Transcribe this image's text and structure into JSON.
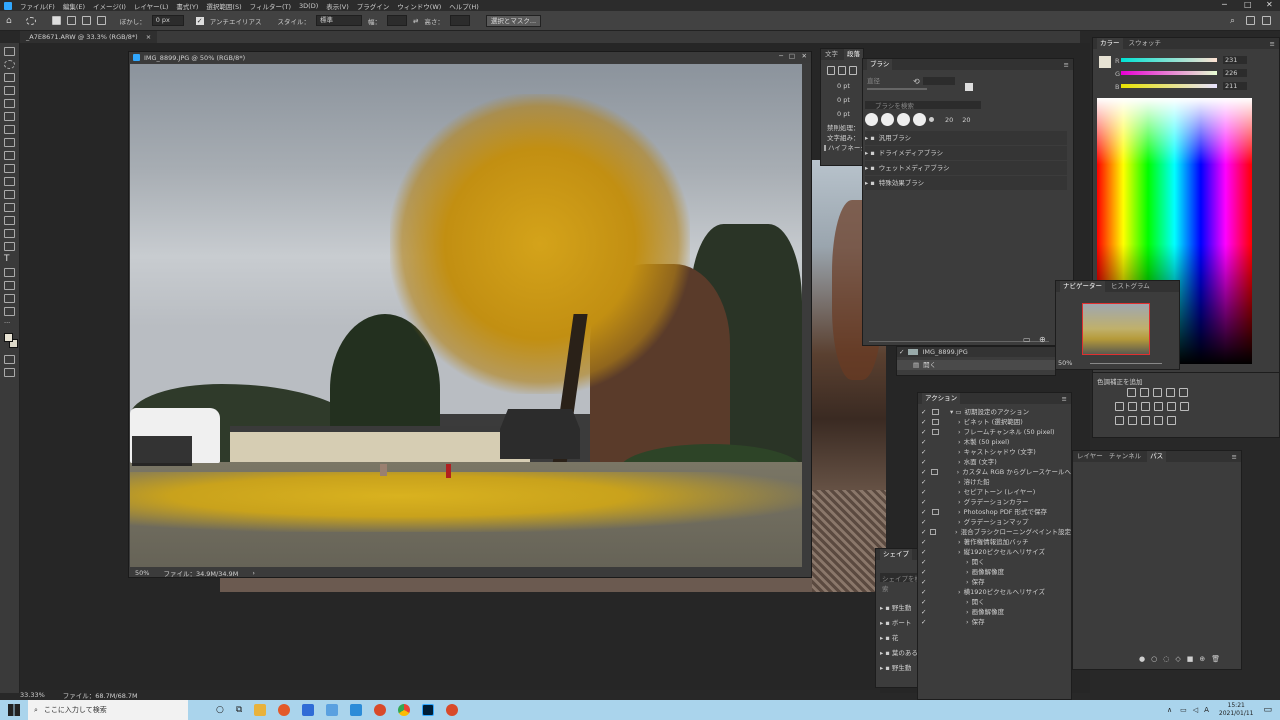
{
  "app": {
    "menus": [
      "ファイル(F)",
      "編集(E)",
      "イメージ(I)",
      "レイヤー(L)",
      "書式(Y)",
      "選択範囲(S)",
      "フィルター(T)",
      "3D(D)",
      "表示(V)",
      "プラグイン",
      "ウィンドウ(W)",
      "ヘルプ(H)"
    ]
  },
  "options": {
    "feather_label": "ぼかし：",
    "feather_value": "0 px",
    "antialias_label": "アンチエイリアス",
    "style_label": "スタイル：",
    "style_value": "標準",
    "width_label": "幅：",
    "height_label": "高さ：",
    "mask_button": "選択とマスク..."
  },
  "doctab": {
    "title": "_A7E8671.ARW @ 33.3% (RGB/8*)",
    "close": "×"
  },
  "document": {
    "title": "IMG_8899.JPG @ 50% (RGB/8*)",
    "zoom": "50%",
    "fileinfo": "ファイル：34.9M/34.9M"
  },
  "status": {
    "zoom": "33.33%",
    "fileinfo": "ファイル：68.7M/68.7M"
  },
  "charpanel": {
    "tabs": [
      "文字",
      "段落"
    ],
    "values": [
      "0 pt",
      "0 pt",
      "0 pt"
    ],
    "label1": "禁則処理：",
    "label2": "文字組み：",
    "hyphen": "ハイフネーシ"
  },
  "brushes": {
    "title": "ブラシ",
    "size_label": "直径",
    "search": "ブラシを検索",
    "sizes": [
      "20",
      "20"
    ],
    "groups": [
      "汎用ブラシ",
      "ドライメディアブラシ",
      "ウェットメディアブラシ",
      "特殊効果ブラシ"
    ]
  },
  "color": {
    "tabs": [
      "カラー",
      "スウォッチ"
    ],
    "r": "231",
    "g": "226",
    "b": "211",
    "labels": [
      "R",
      "G",
      "B"
    ]
  },
  "navigator": {
    "tabs": [
      "ナビゲーター",
      "ヒストグラム"
    ],
    "zoom": "50%"
  },
  "adjust": {
    "title": "色調補正を追加"
  },
  "layers": {
    "tabs": [
      "レイヤー",
      "チャンネル",
      "パス"
    ],
    "row1": "IMG_8899.JPG",
    "row2": "開く"
  },
  "actions": {
    "title": "アクション",
    "items": [
      "初期設定のアクション",
      "ビネット (選択範囲)",
      "フレームチャンネル (50 pixel)",
      "木製 (50 pixel)",
      "キャストシャドウ (文字)",
      "水面 (文字)",
      "カスタム RGB からグレースケールへ",
      "溶けた鉛",
      "セピアトーン (レイヤー)",
      "グラデーションカラー",
      "Photoshop PDF 形式で保存",
      "グラデーションマップ",
      "混合ブラシクローニングペイント設定",
      "著作権情報追加バッチ",
      "縦1920ピクセルへリサイズ",
      "開く",
      "画像解像度",
      "保存",
      "横1920ピクセルへリサイズ",
      "開く",
      "画像解像度",
      "保存"
    ]
  },
  "shapes": {
    "title": "シェイプ",
    "search": "シェイプを検索",
    "items": [
      "野生動",
      "ボート",
      "花",
      "葉のある",
      "野生動"
    ]
  },
  "taskbar": {
    "search": "ここに入力して検索",
    "time": "15:21",
    "date": "2021/01/11",
    "ime": "A"
  }
}
